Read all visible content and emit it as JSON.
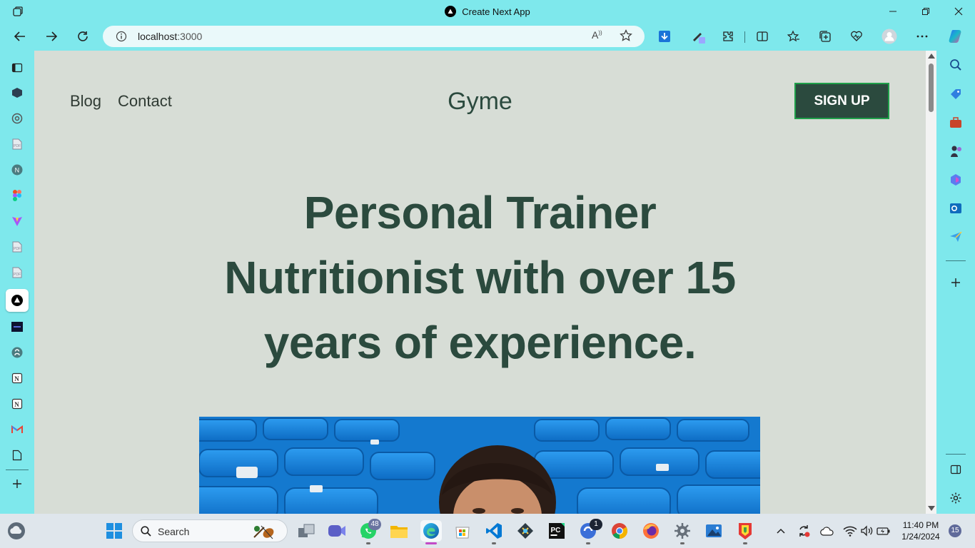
{
  "window": {
    "title": "Create Next App"
  },
  "browser": {
    "url_host": "localhost",
    "url_port": ":3000"
  },
  "page": {
    "nav_links": [
      "Blog",
      "Contact"
    ],
    "brand": "Gyme",
    "signup_label": "SIGN UP",
    "hero_lines": [
      "Personal Trainer",
      "Nutritionist with over 15",
      "years of experience."
    ]
  },
  "taskbar": {
    "search_label": "Search",
    "whatsapp_badge": "48",
    "app_badge": "1",
    "time": "11:40 PM",
    "date": "1/24/2024",
    "notification_count": "15"
  },
  "colors": {
    "chrome": "#7ee8ec",
    "page_bg": "#d7ddd6",
    "brand_green": "#2b4a3e",
    "button_border": "#1fa04a"
  }
}
